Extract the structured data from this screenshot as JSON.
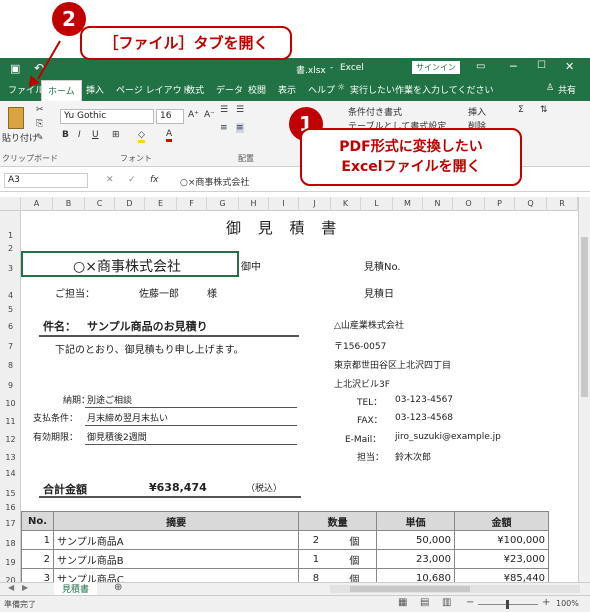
{
  "title_bar": {
    "filename": "書.xlsx",
    "separator": "-",
    "app": "Excel",
    "signin": "サインイン",
    "icons": [
      "save-icon",
      "undo-icon",
      "minimize-icon",
      "restore-icon",
      "close-icon"
    ]
  },
  "tabs": [
    "ファイル",
    "ホーム",
    "挿入",
    "ページ レイアウト",
    "数式",
    "データ",
    "校閲",
    "表示",
    "ヘルプ"
  ],
  "tell_me": "実行したい作業を入力してください",
  "share": "共有",
  "ribbon": {
    "paste": "貼り付け",
    "clipboard": "クリップボード",
    "font_name": "Yu Gothic",
    "font_size": "16",
    "font_group": "フォント",
    "align_group": "配置",
    "cond_format": "条件付き書式",
    "table_format": "テーブルとして書式設定",
    "insert": "挿入",
    "delete": "削除"
  },
  "namebox": "A3",
  "fx": "fx",
  "formula": "○×商事株式会社",
  "columns": [
    "A",
    "B",
    "C",
    "D",
    "E",
    "F",
    "G",
    "H",
    "I",
    "J",
    "K",
    "L",
    "M",
    "N",
    "O",
    "P",
    "Q",
    "R"
  ],
  "rows": [
    "1",
    "2",
    "3",
    "4",
    "5",
    "6",
    "7",
    "8",
    "9",
    "10",
    "11",
    "12",
    "13",
    "14",
    "15",
    "16",
    "17",
    "18",
    "19",
    "20"
  ],
  "sheet": {
    "title": "御 見 積 書",
    "client": "○×商事株式会社",
    "onchu": "御中",
    "mitsumori_no": "見積No.",
    "mitsumori_bi": "見積日",
    "tantou_label": "ご担当：",
    "tantou_name": "佐藤一郎",
    "sama": "様",
    "kenmei_label": "件名：",
    "kenmei": "サンプル商品のお見積り",
    "intro": "下記のとおり、御見積もり申し上げます。",
    "nouki_label": "納期：",
    "nouki": "別途ご相談",
    "shiharai_label": "支払条件：",
    "shiharai": "月末締め翌月末払い",
    "yuukou_label": "有効期限：",
    "yuukou": "御見積後2週間",
    "company": "△山産業株式会社",
    "zip": "〒156-0057",
    "addr1": "東京都世田谷区上北沢四丁目",
    "addr2": "上北沢ビル3F",
    "tel_label": "TEL：",
    "tel": "03-123-4567",
    "fax_label": "FAX：",
    "fax": "03-123-4568",
    "email_label": "E-Mail：",
    "email": "jiro_suzuki@example.jp",
    "rep_label": "担当：",
    "rep": "鈴木次郎",
    "total_label": "合計金額",
    "total": "¥638,474",
    "tax_note": "（税込）",
    "table_headers": [
      "No.",
      "摘要",
      "数量",
      "単価",
      "金額"
    ],
    "items": [
      {
        "no": "1",
        "name": "サンプル商品A",
        "qty": "2",
        "unit": "個",
        "price": "50,000",
        "amount": "¥100,000"
      },
      {
        "no": "2",
        "name": "サンプル商品B",
        "qty": "1",
        "unit": "個",
        "price": "23,000",
        "amount": "¥23,000"
      },
      {
        "no": "3",
        "name": "サンプル商品C",
        "qty": "8",
        "unit": "個",
        "price": "10,680",
        "amount": "¥85,440"
      }
    ]
  },
  "sheet_tab": "見積書",
  "status": "準備完了",
  "zoom": "100%",
  "callout1": {
    "num": "1",
    "line1": "PDF形式に変換したい",
    "line2": "Excelファイルを開く"
  },
  "callout2": {
    "num": "2",
    "text": "［ファイル］タブを開く"
  }
}
